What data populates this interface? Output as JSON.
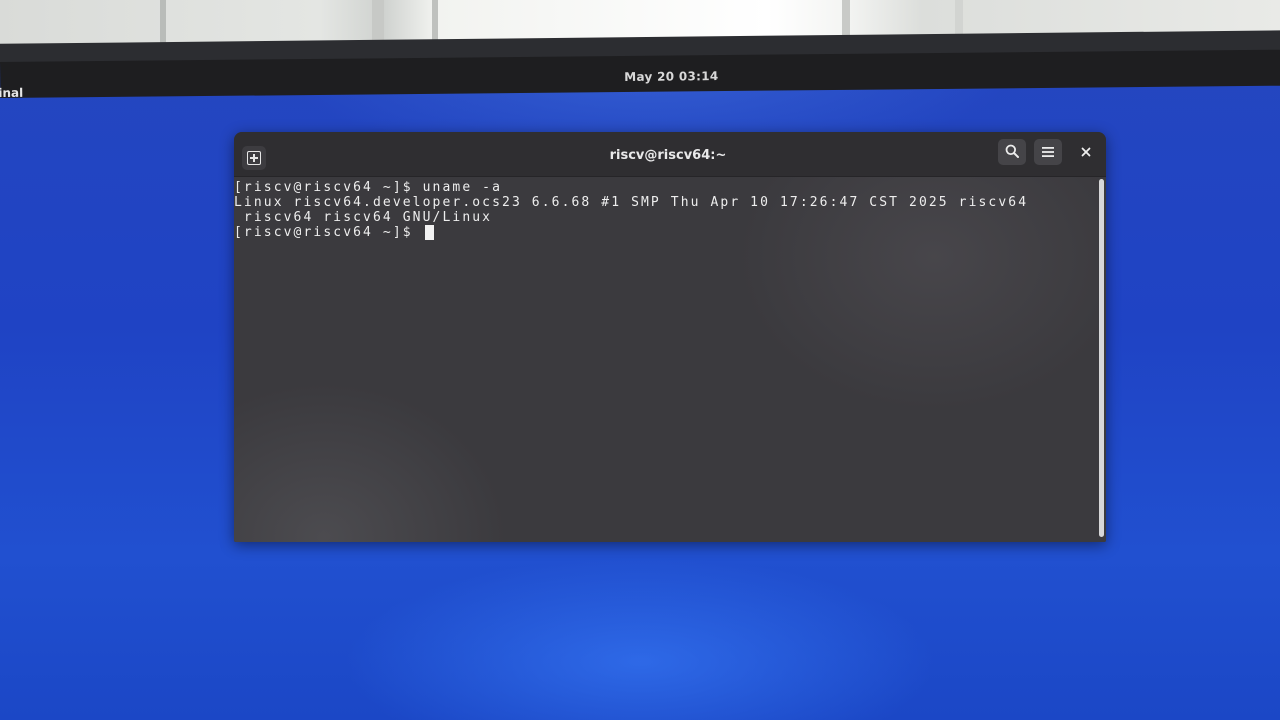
{
  "topbar": {
    "app_menu_label": "inal",
    "clock": "May 20 03:14"
  },
  "window": {
    "title": "riscv@riscv64:~",
    "icons": {
      "new_tab": "new-tab-icon",
      "search": "search-icon",
      "menu": "hamburger-menu-icon",
      "close": "close-icon"
    }
  },
  "terminal": {
    "lines": [
      "[riscv@riscv64 ~]$ uname -a",
      "Linux riscv64.developer.ocs23 6.6.68 #1 SMP Thu Apr 10 17:26:47 CST 2025 riscv64",
      " riscv64 riscv64 GNU/Linux"
    ],
    "prompt": "[riscv@riscv64 ~]$ "
  },
  "colors": {
    "desktop_blue": "#1f43c4",
    "topbar": "#1e1e20",
    "terminal_bg": "#3b3a3e",
    "terminal_text": "#eeeeee"
  }
}
